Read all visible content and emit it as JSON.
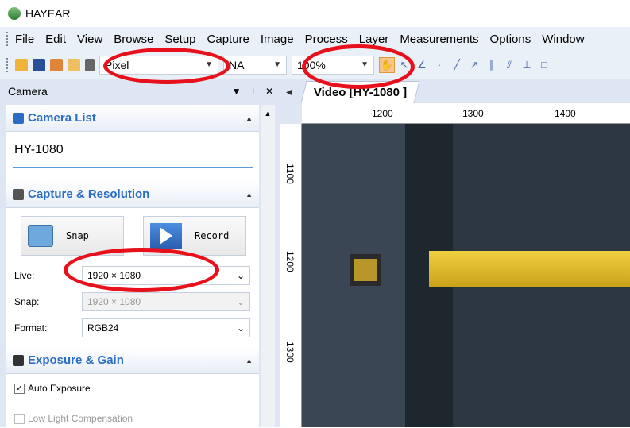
{
  "app": {
    "title": "HAYEAR"
  },
  "menu": [
    "File",
    "Edit",
    "View",
    "Browse",
    "Setup",
    "Capture",
    "Image",
    "Process",
    "Layer",
    "Measurements",
    "Options",
    "Window"
  ],
  "toolbar": {
    "units": "Pixel",
    "calibration": "NA",
    "zoom": "100%"
  },
  "panel": {
    "title": "Camera"
  },
  "camera_list": {
    "title": "Camera List",
    "camera": "HY-1080"
  },
  "capture": {
    "title": "Capture & Resolution",
    "snap_label": "Snap",
    "record_label": "Record",
    "live_label": "Live:",
    "live_value": "1920 × 1080",
    "snap_res_label": "Snap:",
    "snap_res_value": "1920 × 1080",
    "format_label": "Format:",
    "format_value": "RGB24"
  },
  "exposure": {
    "title": "Exposure & Gain",
    "auto_exposure": "Auto Exposure",
    "low_light": "Low Light Compensation"
  },
  "document": {
    "tab": "Video [HY-1080  ]",
    "ruler_x": [
      "1200",
      "1300",
      "1400"
    ],
    "ruler_y": [
      "1100",
      "1200",
      "1300"
    ]
  },
  "annotation_color": "#e8101a"
}
